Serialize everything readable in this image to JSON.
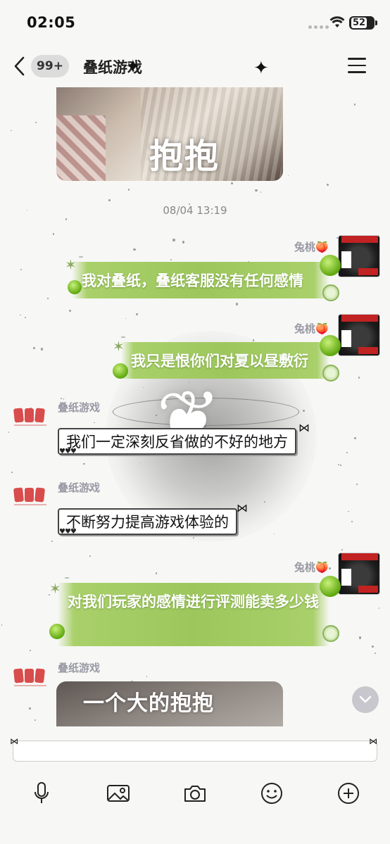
{
  "status_bar": {
    "time": "02:05",
    "battery": "52"
  },
  "nav": {
    "unread_count": "99+",
    "title": "叠纸游戏"
  },
  "messages": {
    "top_image_caption": "抱抱",
    "timestamp": "08/04 13:19",
    "user_name": "兔桃🍑",
    "game_name": "叠纸游戏",
    "user_msg_1": "我对叠纸，叠纸客服没有任何感情",
    "user_msg_2": "我只是恨你们对夏以昼敷衍",
    "game_msg_1": "我们一定深刻反省做的不好的地方",
    "game_msg_2": "不断努力提高游戏体验的",
    "user_msg_3": "对我们玩家的感情进行评测能卖多少钱",
    "bottom_image_caption": "一个大的抱抱"
  },
  "colors": {
    "bubble_green": "#9dc75d",
    "title_text": "#222222",
    "sender_text": "#9a9aa6"
  },
  "icons": [
    "back-icon",
    "menu-icon",
    "microphone-icon",
    "image-icon",
    "camera-icon",
    "emoji-icon",
    "plus-icon",
    "chevron-down-icon"
  ]
}
